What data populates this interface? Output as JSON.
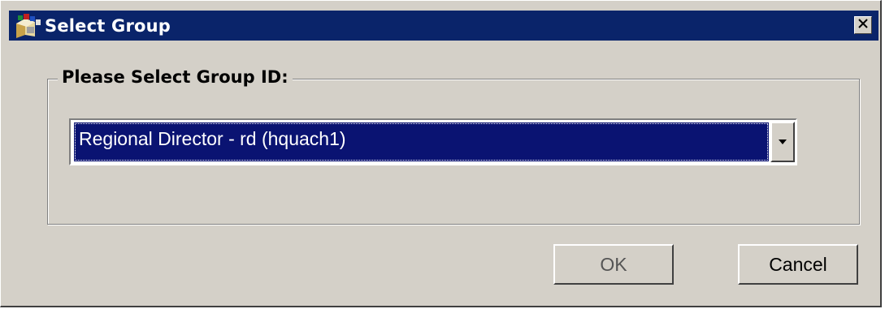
{
  "window": {
    "title": "Select Group",
    "icon": "app-icon",
    "close_icon": "close-icon"
  },
  "group": {
    "legend": "Please Select Group ID:"
  },
  "select": {
    "selected_value": "Regional Director - rd (hquach1)",
    "dropdown_icon": "chevron-down-icon",
    "selection_color": "#0a1372"
  },
  "buttons": {
    "ok_label": "OK",
    "cancel_label": "Cancel"
  },
  "colors": {
    "titlebar": "#0a246a",
    "dialog_bg": "#d4d0c8"
  }
}
